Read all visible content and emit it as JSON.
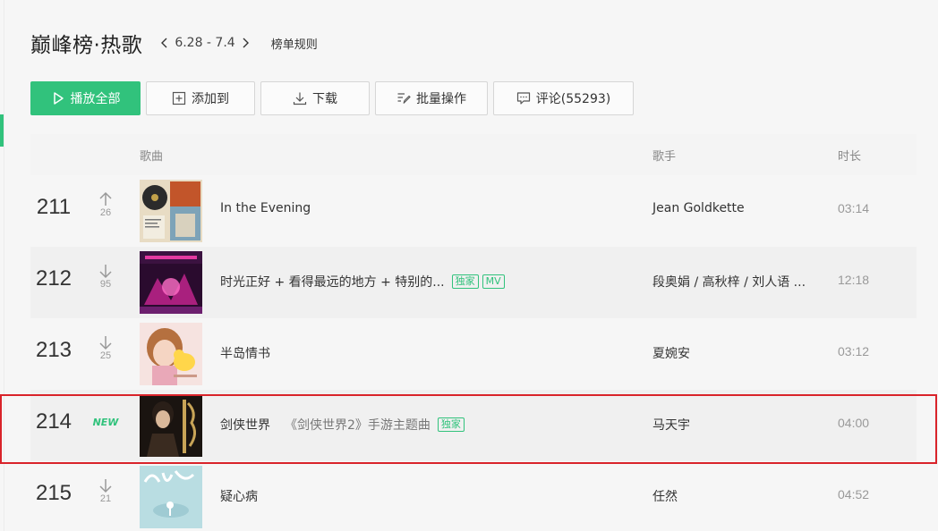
{
  "header": {
    "title": "巅峰榜·热歌",
    "week_range": "6.28 - 7.4",
    "rules_label": "榜单规则"
  },
  "toolbar": {
    "play_all": "播放全部",
    "add_to": "添加到",
    "download": "下载",
    "batch": "批量操作",
    "comments": "评论(55293)"
  },
  "table": {
    "headers": {
      "song": "歌曲",
      "artist": "歌手",
      "duration": "时长"
    },
    "rows": [
      {
        "rank": "211",
        "trend": "up",
        "delta": "26",
        "title": "In the Evening",
        "subtitle": "",
        "tags": [],
        "artist": "Jean Goldkette",
        "duration": "03:14"
      },
      {
        "rank": "212",
        "trend": "down",
        "delta": "95",
        "title": "时光正好 + 看得最远的地方 + 特别的...",
        "subtitle": "",
        "tags": [
          "独家",
          "MV"
        ],
        "artist": "段奥娟 / 高秋梓 / 刘人语 ...",
        "duration": "12:18"
      },
      {
        "rank": "213",
        "trend": "down",
        "delta": "25",
        "title": "半岛情书",
        "subtitle": "",
        "tags": [],
        "artist": "夏婉安",
        "duration": "03:12"
      },
      {
        "rank": "214",
        "trend": "new",
        "delta": "NEW",
        "title": "剑侠世界",
        "subtitle": "《剑侠世界2》手游主题曲",
        "tags": [
          "独家"
        ],
        "artist": "马天宇",
        "duration": "04:00"
      },
      {
        "rank": "215",
        "trend": "down",
        "delta": "21",
        "title": "疑心病",
        "subtitle": "",
        "tags": [],
        "artist": "任然",
        "duration": "04:52"
      }
    ]
  },
  "colors": {
    "accent": "#31c27c",
    "highlight": "#d9232a"
  }
}
